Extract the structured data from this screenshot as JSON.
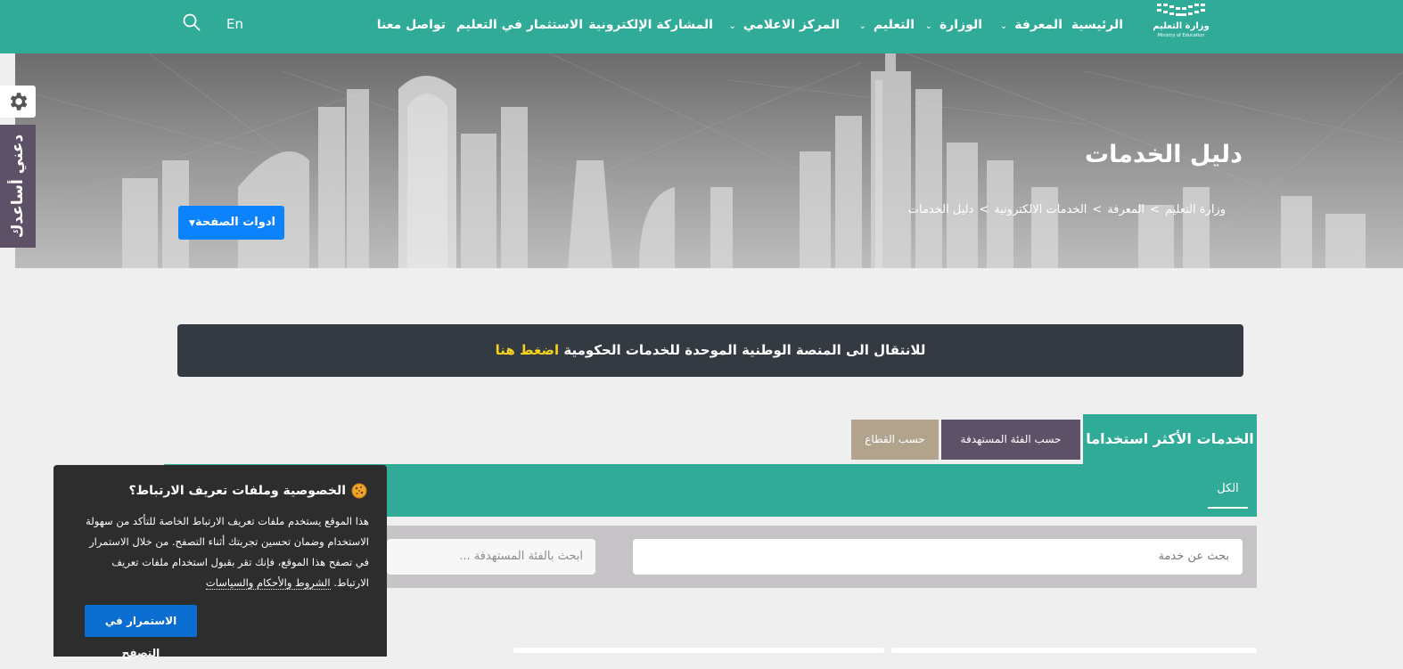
{
  "colors": {
    "primary_teal": "#2fab98",
    "banner_dark": "#343a42",
    "banner_link": "#f5d21b",
    "tab_purple": "#5d5167",
    "tab_tan": "#b2a48c",
    "tools_blue": "#0c83fd",
    "cookie_bg": "#2d2d2d",
    "cookie_button": "#0b6dd0"
  },
  "header": {
    "logo": {
      "arabic": "وزارة التعليم",
      "english": "Ministry of Education"
    },
    "nav": [
      {
        "label": "الرئيسية"
      },
      {
        "label": "المعرفة",
        "icon": "chevron-down-icon"
      },
      {
        "label": "الوزارة",
        "icon": "chevron-down-icon"
      },
      {
        "label": "التعليم",
        "icon": "chevron-down-icon"
      },
      {
        "label": "المركز الاعلامي",
        "icon": "chevron-down-icon"
      },
      {
        "label": "المشاركة الإلكترونية"
      },
      {
        "label": "الاستثمار في التعليم"
      },
      {
        "label": "تواصل معنا"
      }
    ],
    "language": "En",
    "search_icon": "search-icon"
  },
  "hero": {
    "title": "دليل الخدمات",
    "breadcrumb": [
      "وزارة التعليم",
      "المعرفة",
      "الخدمات الالكترونية",
      "دليل الخدمات"
    ],
    "breadcrumb_separator": ">",
    "page_tools_label": "ادوات الصفحة"
  },
  "side": {
    "settings_icon": "gear-icon",
    "help_label": "دعني أساعدك"
  },
  "banner": {
    "text": "للانتقال الى المنصة الوطنية الموحدة للخدمات الحكومية",
    "link": "اضغط هنا"
  },
  "tabs": {
    "most_used": "الخدمات الأكثر استخداما",
    "by_audience": "حسب الفئة المستهدفة",
    "by_sector": "حسب القطاع",
    "sub_all": "الكل"
  },
  "filters": {
    "search_placeholder": "بحث عن خدمة",
    "audience_placeholder": "ابحث بالفئة المستهدفة ..."
  },
  "cookie": {
    "title": "الخصوصية وملفات تعريف الارتباط؟",
    "body": "هذا الموقع يستخدم ملفات تعريف الارتباط الخاصة للتأكد من سهولة الاستخدام وضمان تحسين تجربتك أثناء التصفح. من خلال الاستمرار في تصفح هذا الموقع، فإنك تقر بقبول استخدام ملفات تعريف الارتباط.",
    "terms_link": "الشروط والأحكام والسياسات",
    "button": "الاستمرار في التصفح",
    "icon": "cookie-icon"
  }
}
